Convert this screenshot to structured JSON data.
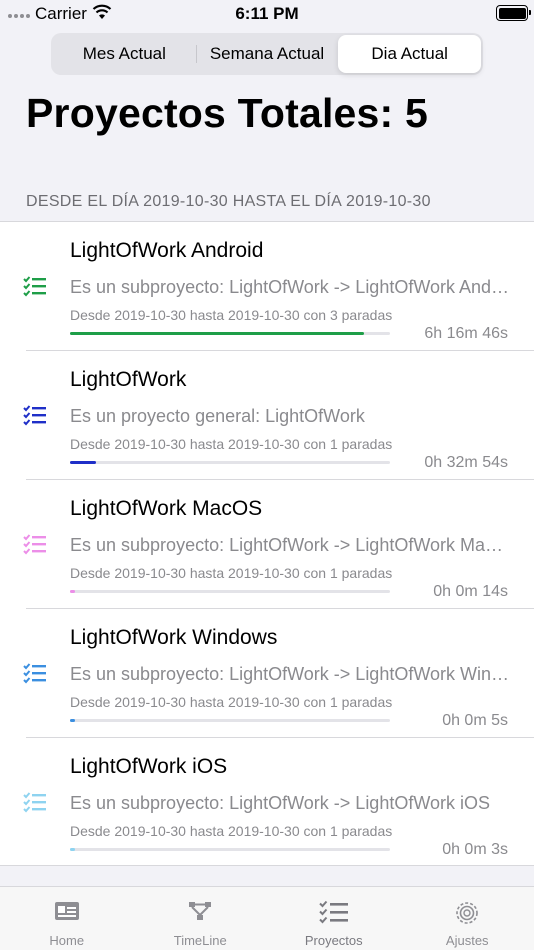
{
  "status_bar": {
    "carrier": "Carrier",
    "time": "6:11 PM"
  },
  "segments": [
    {
      "label": "Mes Actual",
      "selected": false
    },
    {
      "label": "Semana Actual",
      "selected": false
    },
    {
      "label": "Dia Actual",
      "selected": true
    }
  ],
  "title": "Proyectos Totales: 5",
  "section_header": "DESDE EL DÍA 2019-10-30 HASTA EL DÍA 2019-10-30",
  "projects": [
    {
      "name": "LightOfWork Android",
      "subtitle": "Es un subproyecto: LightOfWork -> LightOfWork Android",
      "range": "Desde 2019-10-30 hasta 2019-10-30 con 3 paradas",
      "duration": "6h 16m 46s",
      "progress": 0.92,
      "color": "#1e9e48",
      "icon": "checklist-icon"
    },
    {
      "name": "LightOfWork",
      "subtitle": "Es un proyecto general: LightOfWork",
      "range": "Desde 2019-10-30 hasta 2019-10-30 con 1 paradas",
      "duration": "0h 32m 54s",
      "progress": 0.08,
      "color": "#1f2fc8",
      "icon": "checklist-icon"
    },
    {
      "name": "LightOfWork MacOS",
      "subtitle": "Es un subproyecto: LightOfWork -> LightOfWork MacOS",
      "range": "Desde 2019-10-30 hasta 2019-10-30 con 1 paradas",
      "duration": "0h 0m 14s",
      "progress": 0.015,
      "color": "#ec8ee8",
      "icon": "checklist-icon"
    },
    {
      "name": "LightOfWork Windows",
      "subtitle": "Es un subproyecto: LightOfWork -> LightOfWork Windows",
      "range": "Desde 2019-10-30 hasta 2019-10-30 con 1 paradas",
      "duration": "0h 0m 5s",
      "progress": 0.015,
      "color": "#3b8fe0",
      "icon": "checklist-icon"
    },
    {
      "name": "LightOfWork iOS",
      "subtitle": "Es un subproyecto: LightOfWork -> LightOfWork iOS",
      "range": "Desde 2019-10-30 hasta 2019-10-30 con 1 paradas",
      "duration": "0h 0m 3s",
      "progress": 0.015,
      "color": "#8ed3f0",
      "icon": "checklist-icon"
    }
  ],
  "tabs": [
    {
      "label": "Home",
      "icon": "id-card-icon",
      "selected": false
    },
    {
      "label": "TimeLine",
      "icon": "timeline-icon",
      "selected": false
    },
    {
      "label": "Proyectos",
      "icon": "checklist-icon",
      "selected": true
    },
    {
      "label": "Ajustes",
      "icon": "gear-icon",
      "selected": false
    }
  ]
}
